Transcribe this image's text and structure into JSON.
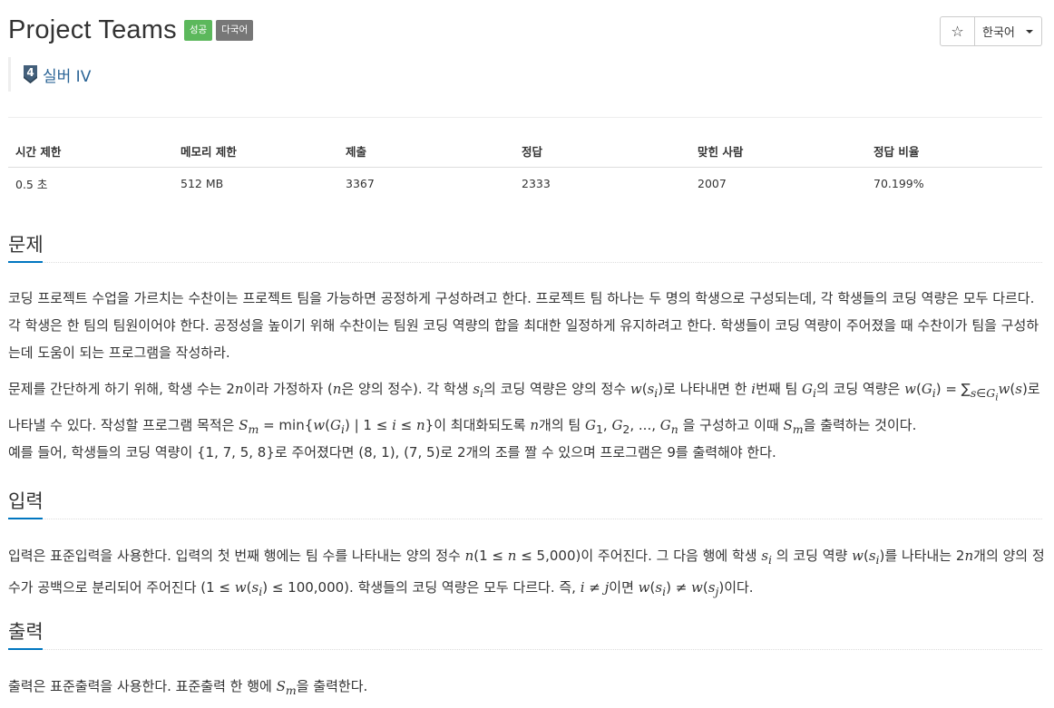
{
  "title": "Project Teams",
  "badges": {
    "success": "성공",
    "multilang": "다국어"
  },
  "tier": {
    "number": "4",
    "label": "실버 IV"
  },
  "actions": {
    "star": "☆",
    "language": "한국어"
  },
  "info_table": {
    "headers": [
      "시간 제한",
      "메모리 제한",
      "제출",
      "정답",
      "맞힌 사람",
      "정답 비율"
    ],
    "values": [
      "0.5 초",
      "512 MB",
      "3367",
      "2333",
      "2007",
      "70.199%"
    ]
  },
  "sections": {
    "problem": {
      "heading": "문제",
      "p1": "코딩 프로젝트 수업을 가르치는 수찬이는 프로젝트 팀을 가능하면 공정하게 구성하려고 한다. 프로젝트 팀 하나는 두 명의 학생으로 구성되는데, 각 학생들의 코딩 역량은 모두 다르다. 각 학생은 한 팀의 팀원이어야 한다. 공정성을 높이기 위해 수찬이는 팀원 코딩 역량의 합을 최대한 일정하게 유지하려고 한다. 학생들이 코딩 역량이 주어졌을 때 수찬이가 팀을 구성하는데 도움이 되는 프로그램을 작성하라.",
      "p2": {
        "t1": "문제를 간단하게 하기 위해, 학생 수는 2",
        "t2": "이라 가정하자 (",
        "t3": "은 양의 정수). 각 학생 ",
        "t4": "의 코딩 역량은 양의 정수 ",
        "t5": "로 나타내면 한 ",
        "t6": "번째 팀 ",
        "t7": "의 코딩 역량은 ",
        "t8": "로 나타낼 수 있다. 작성할 프로그램 목적은 ",
        "t9": " = min{",
        "t10": " | 1 ≤ ",
        "t11": " ≤ ",
        "t12": "}이 최대화되도록 ",
        "t13": "개의 팀 ",
        "t14": " 을 구성하고 이때 ",
        "t15": "을 출력하는 것이다."
      },
      "p3": "예를 들어, 학생들의 코딩 역량이 {1, 7, 5, 8}로 주어졌다면 (8, 1), (7, 5)로 2개의 조를 짤 수 있으며 프로그램은 9를 출력해야 한다."
    },
    "input": {
      "heading": "입력",
      "p": {
        "t1": "입력은 표준입력을 사용한다. 입력의 첫 번째 행에는 팀 수를 나타내는 양의 정수 ",
        "t2": "(1 ≤ ",
        "t3": " ≤ 5,000)이 주어진다. 그 다음 행에 학생 ",
        "t4": " 의 코딩 역량 ",
        "t5": "를 나타내는 2",
        "t6": "개의 양의 정수가 공백으로 분리되어 주어진다 (1 ≤ ",
        "t7": " ≤ 100,000). 학생들의 코딩 역량은 모두 다르다. 즉, ",
        "t8": " ≠ ",
        "t9": "이면 ",
        "t10": " ≠ ",
        "t11": "이다."
      }
    },
    "output": {
      "heading": "출력",
      "p": {
        "t1": "출력은 표준출력을 사용한다. 표준출력 한 행에 ",
        "t2": "을 출력한다."
      }
    }
  },
  "colors": {
    "accent": "#0076c0",
    "success": "#5cb85c",
    "multilang": "#777777",
    "tier_silver": "#435f7a",
    "link": "#2a6496"
  },
  "icons": {
    "tier": "silver-tier-shield-icon",
    "star": "star-outline-icon",
    "caret": "caret-down-icon"
  }
}
